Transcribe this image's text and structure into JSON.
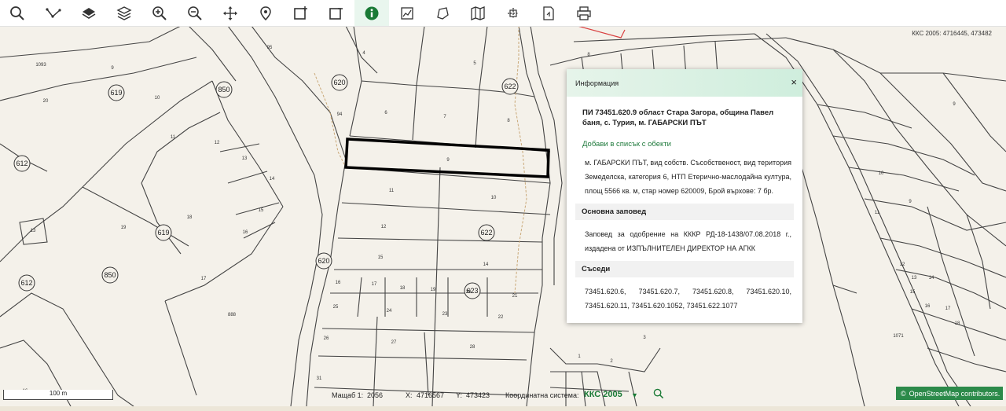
{
  "toolbar": {
    "icons": [
      "search-icon",
      "measure-icon",
      "layers-stack-icon",
      "layers-icon",
      "zoom-in-icon",
      "zoom-out-icon",
      "pan-icon",
      "location-pin-icon",
      "select-box-icon",
      "deselect-box-icon",
      "info-icon",
      "chart-icon",
      "polygon-icon",
      "map-icon",
      "crop-icon",
      "export-icon",
      "print-icon"
    ],
    "active": "info-icon"
  },
  "map": {
    "top_coords": "ККС 2005: 4716445, 473482",
    "area_labels": [
      "619",
      "850",
      "612",
      "620",
      "622",
      "623",
      "612",
      "619",
      "850",
      "620"
    ],
    "parcel_numbers": [
      "9",
      "10",
      "11",
      "12",
      "13",
      "14",
      "15",
      "16",
      "17",
      "18",
      "19",
      "20",
      "4",
      "5",
      "6",
      "7",
      "8",
      "9",
      "10",
      "11",
      "12",
      "15",
      "16",
      "17",
      "18",
      "19",
      "21",
      "22",
      "23",
      "24",
      "25",
      "26",
      "27",
      "28",
      "31",
      "94",
      "95",
      "1093",
      "888",
      "13",
      "14",
      "8",
      "9",
      "10",
      "11",
      "12",
      "13",
      "14",
      "15",
      "16",
      "17",
      "18",
      "1",
      "2",
      "3",
      "1071"
    ]
  },
  "popup": {
    "header": "Информация",
    "close": "×",
    "title": "ПИ 73451.620.9 област Стара Загора, община Павел баня, с. Турия, м. ГАБАРСКИ ПЪТ",
    "add_link": "Добави в списък с обекти",
    "description": "м. ГАБАРСКИ ПЪТ, вид собств. Съсобственост, вид територия Земеделска, категория 6, НТП Етерично-маслодайна култура, площ 5566 кв. м, стар номер 620009, Брой върхове: 7 бр.",
    "order_heading": "Основна заповед",
    "order_text": "Заповед за одобрение на КККР РД-18-1438/07.08.2018 г., издадена от ИЗПЪЛНИТЕЛЕН ДИРЕКТОР НА АГКК",
    "neighbors_heading": "Съседи",
    "neighbors_text": "73451.620.6, 73451.620.7, 73451.620.8, 73451.620.10, 73451.620.11, 73451.620.1052, 73451.622.1077"
  },
  "status": {
    "scale_bar": "100 m",
    "scale_label": "Мащаб 1:",
    "scale_value": "2056",
    "x_label": "X:",
    "x_value": "4716567",
    "y_label": "Y:",
    "y_value": "473423",
    "cs_label": "Координатна система:",
    "cs_value": "ККС 2005",
    "cs_arrow": "▼"
  },
  "attribution": {
    "symbol": "©",
    "text": "OpenStreetMap contributors."
  },
  "colors": {
    "accent": "#1a7a36",
    "map_bg": "#f4f1ea",
    "parcel_line": "#444444",
    "selected_parcel": "#000000"
  }
}
